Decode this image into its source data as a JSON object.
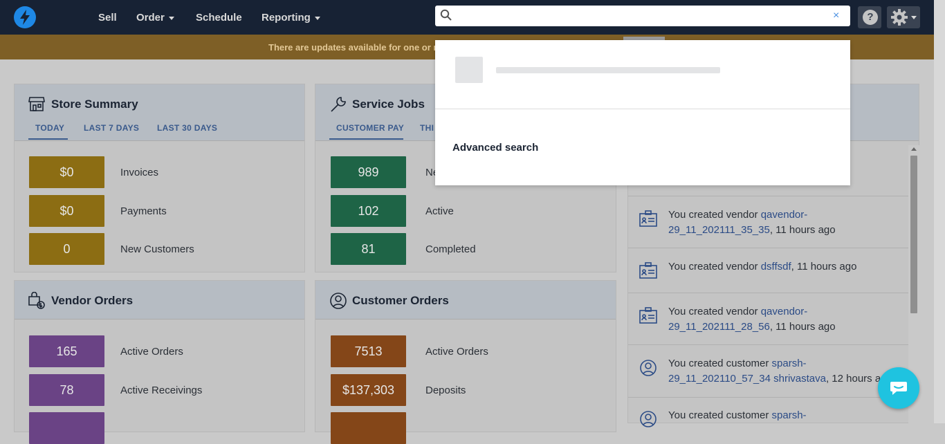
{
  "nav": {
    "items": [
      {
        "label": "Sell"
      },
      {
        "label": "Order"
      },
      {
        "label": "Schedule"
      },
      {
        "label": "Reporting"
      }
    ],
    "search": {
      "value": "",
      "placeholder": ""
    },
    "clear_label": "×",
    "help_label": "?"
  },
  "banner": {
    "text": "There are updates available for one or m"
  },
  "store_summary": {
    "title": "Store Summary",
    "tabs": [
      "TODAY",
      "LAST 7 DAYS",
      "LAST 30 DAYS"
    ],
    "stats": [
      {
        "value": "$0",
        "label": "Invoices"
      },
      {
        "value": "$0",
        "label": "Payments"
      },
      {
        "value": "0",
        "label": "New Customers"
      }
    ]
  },
  "service_jobs": {
    "title": "Service Jobs",
    "tabs": [
      "CUSTOMER PAY",
      "THI"
    ],
    "stats": [
      {
        "value": "989",
        "label": "Ne"
      },
      {
        "value": "102",
        "label": "Active"
      },
      {
        "value": "81",
        "label": "Completed"
      }
    ]
  },
  "vendor_orders": {
    "title": "Vendor Orders",
    "stats": [
      {
        "value": "165",
        "label": "Active Orders"
      },
      {
        "value": "78",
        "label": "Active Receivings"
      }
    ]
  },
  "customer_orders": {
    "title": "Customer Orders",
    "stats": [
      {
        "value": "7513",
        "label": "Active Orders"
      },
      {
        "value": "$137,303",
        "label": "Deposits"
      }
    ]
  },
  "activity": {
    "items": [
      {
        "prefix": "You created vendor ",
        "link": "qavendor-29_11_202111_35_35",
        "suffix": ", 11 hours ago"
      },
      {
        "prefix": "You created vendor ",
        "link": "dsffsdf",
        "suffix": ", 11 hours ago"
      },
      {
        "prefix": "You created vendor ",
        "link": "qavendor-29_11_202111_28_56",
        "suffix": ", 11 hours ago"
      },
      {
        "prefix": "You created customer ",
        "link": "sparsh-29_11_202110_57_34 shrivastava",
        "suffix": ", 12 hours ago"
      },
      {
        "prefix": "You created customer ",
        "link": "sparsh-",
        "suffix": ""
      }
    ]
  },
  "search_dropdown": {
    "advanced_search_label": "Advanced search"
  },
  "colors": {
    "nav_bg": "#172234",
    "banner_bg": "#f39c12",
    "amber": "#f0b323",
    "green": "#2bb673",
    "purple": "#a16bcf",
    "orange": "#e86f2a",
    "link": "#3a6fd8",
    "chat": "#1fc3e0"
  }
}
